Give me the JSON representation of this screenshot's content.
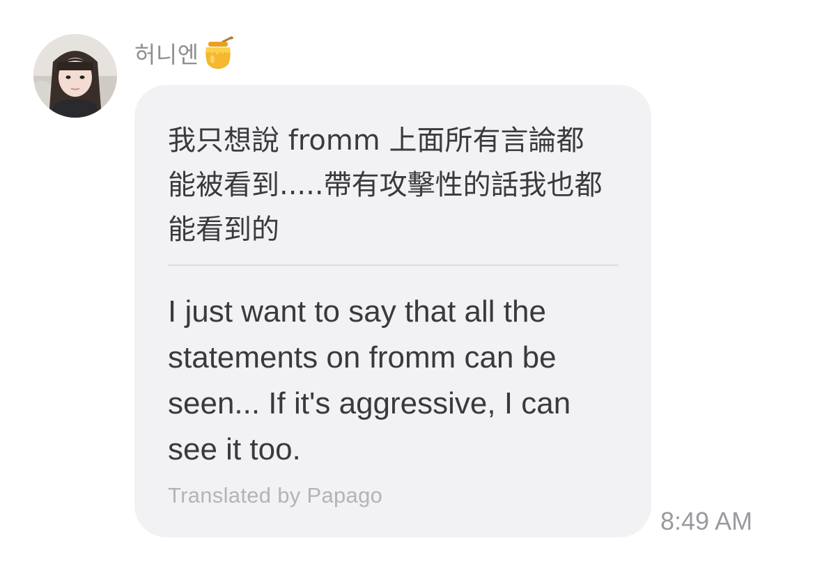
{
  "sender": {
    "name": "허니엔",
    "badge_icon": "honey-pot-icon",
    "avatar_icon": "profile-photo-avatar"
  },
  "message": {
    "original_line_1": "我只想說 fromm 上面所有言論都",
    "original_line_2": "能被看到.....帶有攻擊性的話我也都",
    "original_line_3": "能看到的",
    "translated_line_1": "I just want to say that all the",
    "translated_line_2": "statements on fromm can be",
    "translated_line_3": "seen... If it's aggressive, I can",
    "translated_line_4": "see it too.",
    "translation_credit": "Translated by Papago",
    "timestamp": "8:49 AM"
  },
  "colors": {
    "bubble_background": "#f2f2f4",
    "primary_text": "#3a3a3c",
    "secondary_text": "#8e8e93",
    "credit_text": "#b3b3b8",
    "honey": "#f5b82e"
  }
}
